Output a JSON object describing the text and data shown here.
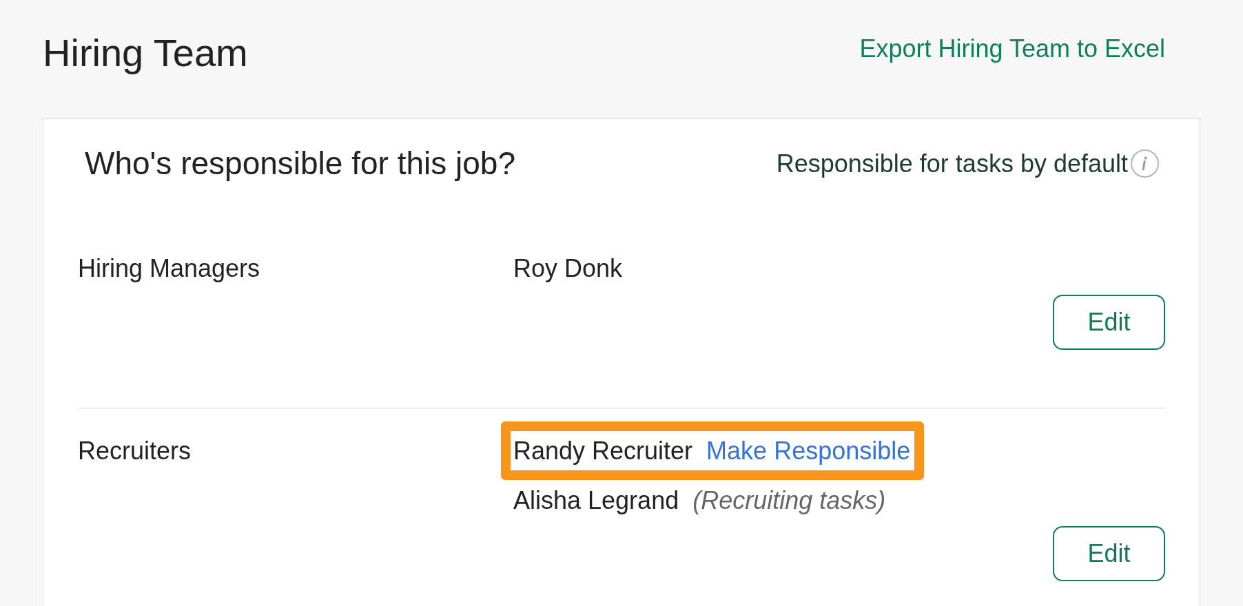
{
  "page": {
    "title": "Hiring Team",
    "export_link": "Export Hiring Team to Excel"
  },
  "card": {
    "title": "Who's responsible for this job?",
    "default_note": "Responsible for tasks by default"
  },
  "groups": [
    {
      "label": "Hiring Managers",
      "members": [
        {
          "name": "Roy Donk",
          "highlighted": false
        }
      ],
      "button": "Edit"
    },
    {
      "label": "Recruiters",
      "members": [
        {
          "name": "Randy Recruiter",
          "highlighted": true,
          "action": "Make Responsible"
        },
        {
          "name": "Alisha Legrand",
          "highlighted": false,
          "note": "(Recruiting tasks)"
        }
      ],
      "button": "Edit"
    }
  ]
}
